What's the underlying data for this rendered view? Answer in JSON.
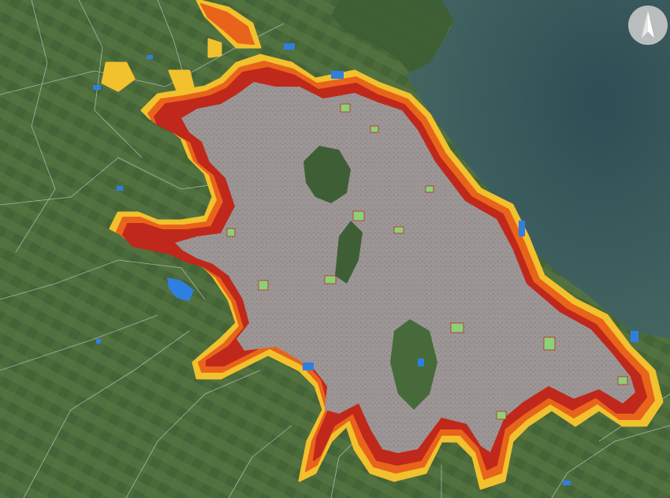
{
  "map": {
    "type": "satellite-overlay",
    "legend": [],
    "colors": {
      "land": "#4f6f3e",
      "land_dark": "#3e5a30",
      "water": "#3b5a58",
      "water_deep": "#2e4a52",
      "urban_core": "#9a9696",
      "urban_fringe_high": "#c0281c",
      "urban_fringe_mid": "#e8641a",
      "urban_fringe_low": "#f2c12e",
      "green_patch": "#8cd17a",
      "water_body": "#2f7fe0",
      "boundary_line": "#c9d3d0"
    }
  },
  "compass": {
    "icon": "north-arrow-icon"
  }
}
